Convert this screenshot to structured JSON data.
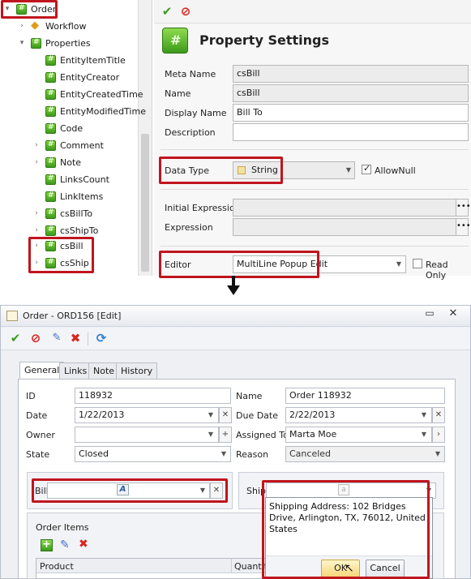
{
  "tree": {
    "root": "Order",
    "workflow": "Workflow",
    "properties": "Properties",
    "items": [
      "EntityItemTitle",
      "EntityCreator",
      "EntityCreatedTime",
      "EntityModifiedTime",
      "Code",
      "Comment",
      "Note",
      "LinksCount",
      "LinkItems",
      "csBillTo",
      "csShipTo",
      "csBill",
      "csShip"
    ]
  },
  "property_settings": {
    "title": "Property Settings",
    "labels": {
      "meta_name": "Meta Name",
      "name": "Name",
      "display_name": "Display Name",
      "description": "Description",
      "data_type": "Data Type",
      "allow_null": "AllowNull",
      "initial_expression": "Initial Expression",
      "expression": "Expression",
      "editor": "Editor",
      "read_only": "Read Only"
    },
    "values": {
      "meta_name": "csBill",
      "name": "csBill",
      "display_name": "Bill To",
      "description": "",
      "data_type": "String",
      "allow_null": true,
      "initial_expression": "",
      "expression": "",
      "editor": "MultiLine Popup Edit",
      "read_only": false
    }
  },
  "window": {
    "title": "Order - ORD156 [Edit]",
    "tabs": [
      "General",
      "Links",
      "Note",
      "History"
    ],
    "active_tab": "General",
    "labels": {
      "id": "ID",
      "name": "Name",
      "date": "Date",
      "due_date": "Due Date",
      "owner": "Owner",
      "assigned_to": "Assigned To",
      "state": "State",
      "reason": "Reason",
      "bill": "Bill",
      "ship": "Ship",
      "order_items": "Order Items",
      "product": "Product",
      "quantity": "Quantit"
    },
    "values": {
      "id": "118932",
      "name": "Order 118932",
      "date": "1/22/2013",
      "due_date": "2/22/2013",
      "owner": "",
      "assigned_to": "Marta Moe",
      "state": "Closed",
      "reason": "Canceled",
      "bill": "",
      "ship": ""
    },
    "popup_text": "Shipping Address: 102 Bridges Drive, Arlington, TX, 76012, United States",
    "ok_label": "OK",
    "cancel_label": "Cancel"
  },
  "colors": {
    "highlight": "#c0151d",
    "accent_green": "#3e9b1c",
    "delete_red": "#d9241c"
  }
}
